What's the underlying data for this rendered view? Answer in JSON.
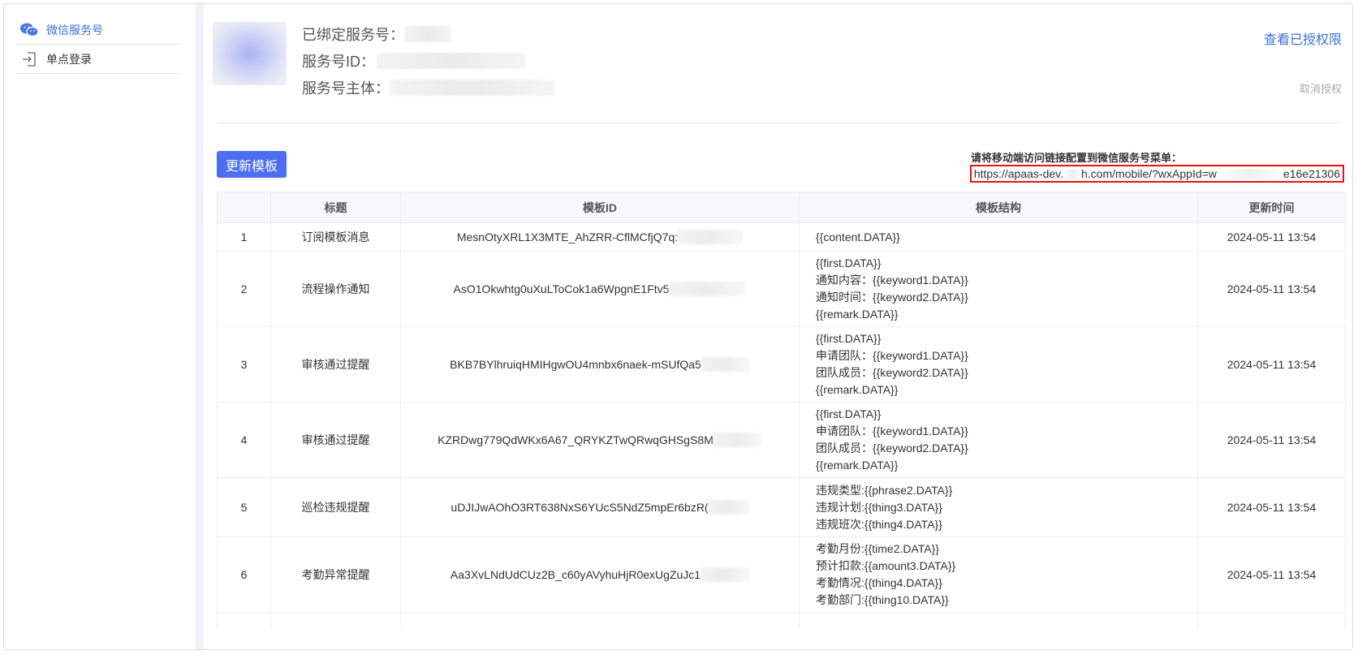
{
  "sidebar": {
    "items": [
      {
        "label": "微信服务号",
        "icon": "wechat-icon",
        "active": true
      },
      {
        "label": "单点登录",
        "icon": "login-icon",
        "active": false
      }
    ]
  },
  "account": {
    "bound_label": "已绑定服务号：",
    "id_label": "服务号ID：",
    "owner_label": "服务号主体：",
    "view_permissions": "查看已授权限",
    "revoke": "取消授权"
  },
  "toolbar": {
    "update_button": "更新模板",
    "hint": "请将移动端访问链接配置到微信服务号菜单：",
    "url_part1": "https://apaas-dev.",
    "url_part2": "h.com/mobile/?wxAppId=w",
    "url_part3": "e16e21306"
  },
  "table": {
    "headers": [
      "",
      "标题",
      "模板ID",
      "模板结构",
      "更新时间"
    ],
    "rows": [
      {
        "no": "1",
        "title": "订阅模板消息",
        "id": "MesnOtyXRL1X3MTE_AhZRR-CflMCfjQ7q:",
        "structure": [
          "{{content.DATA}}"
        ],
        "time": "2024-05-11 13:54"
      },
      {
        "no": "2",
        "title": "流程操作通知",
        "id": "AsO1Okwhtg0uXuLToCok1a6WpgnE1Ftv5",
        "structure": [
          "{{first.DATA}}",
          "通知内容：{{keyword1.DATA}}",
          "通知时间：{{keyword2.DATA}}",
          "{{remark.DATA}}"
        ],
        "time": "2024-05-11 13:54"
      },
      {
        "no": "3",
        "title": "审核通过提醒",
        "id": "BKB7BYlhruiqHMIHgwOU4mnbx6naek-mSUfQa5",
        "structure": [
          "{{first.DATA}}",
          "申请团队：{{keyword1.DATA}}",
          "团队成员：{{keyword2.DATA}}",
          "{{remark.DATA}}"
        ],
        "time": "2024-05-11 13:54"
      },
      {
        "no": "4",
        "title": "审核通过提醒",
        "id": "KZRDwg779QdWKx6A67_QRYKZTwQRwqGHSgS8M",
        "structure": [
          "{{first.DATA}}",
          "申请团队：{{keyword1.DATA}}",
          "团队成员：{{keyword2.DATA}}",
          "{{remark.DATA}}"
        ],
        "time": "2024-05-11 13:54"
      },
      {
        "no": "5",
        "title": "巡检违规提醒",
        "id": "uDJIJwAOhO3RT638NxS6YUcS5NdZ5mpEr6bzR(",
        "structure": [
          "违规类型:{{phrase2.DATA}}",
          "违规计划:{{thing3.DATA}}",
          "违规班次:{{thing4.DATA}}"
        ],
        "time": "2024-05-11 13:54"
      },
      {
        "no": "6",
        "title": "考勤异常提醒",
        "id": "Aa3XvLNdUdCUz2B_c60yAVyhuHjR0exUgZuJc1",
        "structure": [
          "考勤月份:{{time2.DATA}}",
          "预计扣款:{{amount3.DATA}}",
          "考勤情况:{{thing4.DATA}}",
          "考勤部门:{{thing10.DATA}}"
        ],
        "time": "2024-05-11 13:54"
      }
    ]
  },
  "colors": {
    "accent": "#3f6fd8",
    "button": "#4d6ef0",
    "highlight_border": "#e8121a"
  }
}
